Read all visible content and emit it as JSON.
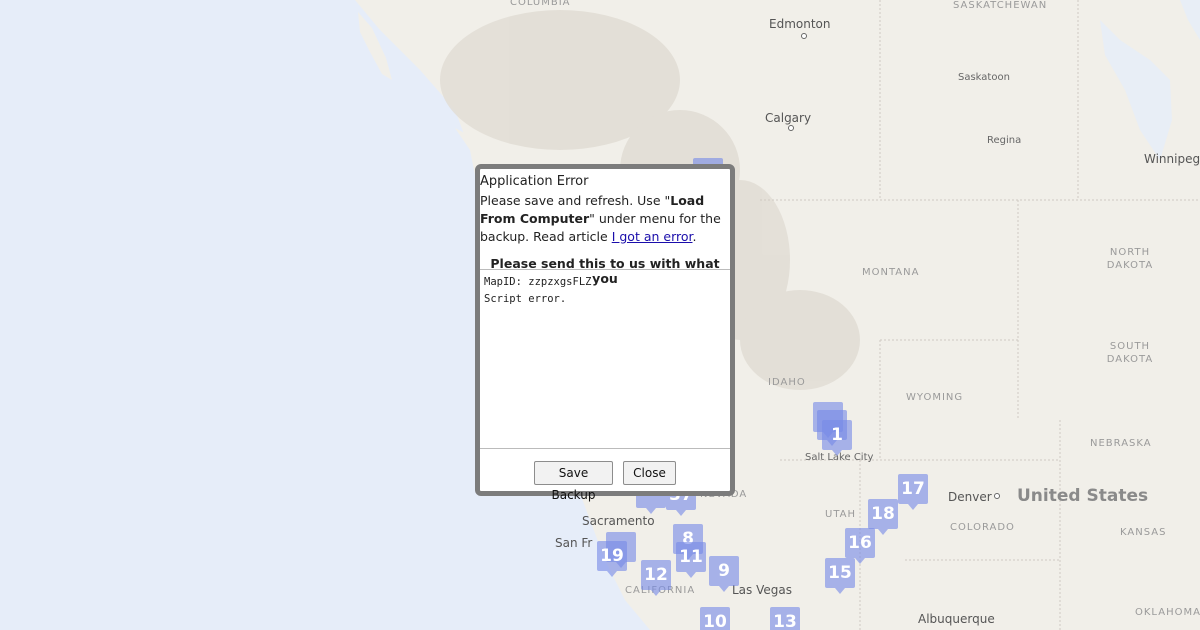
{
  "map": {
    "cities": [
      {
        "name": "Edmonton",
        "dot": true
      },
      {
        "name": "Saskatoon",
        "dot": false
      },
      {
        "name": "Calgary",
        "dot": true
      },
      {
        "name": "Regina",
        "dot": false
      },
      {
        "name": "Winnipeg",
        "dot": false
      },
      {
        "name": "Salt Lake City",
        "dot": false
      },
      {
        "name": "Denver",
        "dot": true
      },
      {
        "name": "Sacramento",
        "dot": false
      },
      {
        "name": "San Fr",
        "dot": false
      },
      {
        "name": "Las Vegas",
        "dot": false
      },
      {
        "name": "Albuquerque",
        "dot": false
      }
    ],
    "regions": [
      "COLUMBIA",
      "SASKATCHEWAN",
      "NORTH DAKOTA",
      "MONTANA",
      "SOUTH DAKOTA",
      "IDAHO",
      "WYOMING",
      "NEBRASKA",
      "UTAH",
      "COLORADO",
      "KANSAS",
      "NEVADA",
      "CALIFORNIA",
      "OKLAHOMA"
    ],
    "country": "United States",
    "markers": [
      "1",
      "17",
      "18",
      "16",
      "15",
      "19",
      "12",
      "11",
      "9",
      "8",
      "37",
      "10",
      "13"
    ]
  },
  "dialog": {
    "title": "Application Error",
    "msg_part1": "Please save and refresh. Use \"",
    "msg_bold": "Load From Computer",
    "msg_part2": "\" under menu for the backup. Read article ",
    "msg_link": "I got an error",
    "msg_end": ".",
    "send_label": "Please send this to us with what you",
    "log_lines": [
      "MapID: zzpzxgsFLZ",
      "Script error."
    ],
    "save_backup_label": "Save Backup",
    "close_label": "Close"
  },
  "colors": {
    "water": "#e6edf9",
    "land": "#f1efe9",
    "marker": "#788ae6",
    "dialog_border": "#7c7c7c",
    "link": "#1a0dab"
  }
}
